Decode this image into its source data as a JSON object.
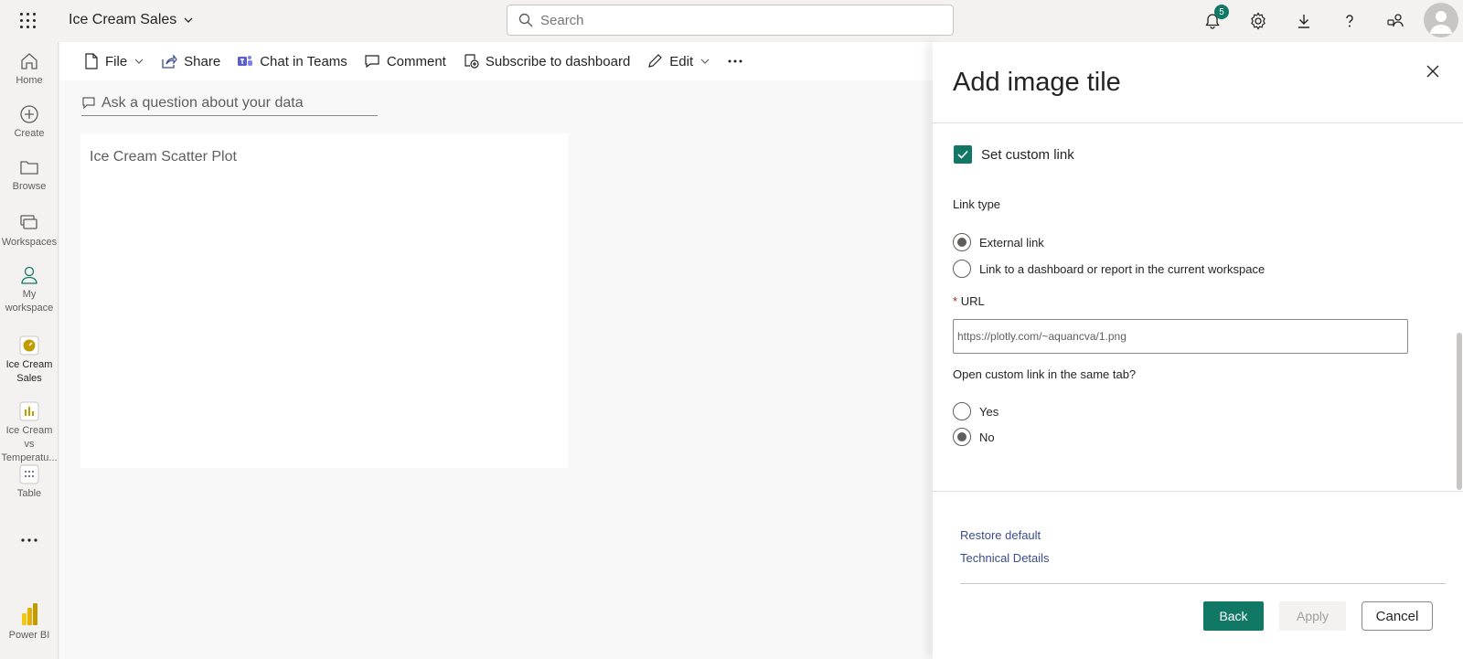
{
  "header": {
    "app_title": "Ice Cream Sales",
    "search_placeholder": "Search",
    "notification_count": "5"
  },
  "nav": {
    "home": "Home",
    "create": "Create",
    "browse": "Browse",
    "workspaces": "Workspaces",
    "my_workspace_1": "My",
    "my_workspace_2": "workspace",
    "ice_cream_sales_1": "Ice Cream",
    "ice_cream_sales_2": "Sales",
    "ice_vs_temp_1": "Ice Cream vs",
    "ice_vs_temp_2": "Temperatu...",
    "table": "Table",
    "power_bi": "Power BI"
  },
  "toolbar": {
    "file": "File",
    "share": "Share",
    "chat_in_teams": "Chat in Teams",
    "comment": "Comment",
    "subscribe": "Subscribe to dashboard",
    "edit": "Edit"
  },
  "canvas": {
    "qna_placeholder": "Ask a question about your data",
    "tile_title": "Ice Cream Scatter Plot"
  },
  "panel": {
    "title": "Add image tile",
    "set_custom_link": "Set custom link",
    "link_type_label": "Link type",
    "external_link": "External link",
    "dashboard_link": "Link to a dashboard or report in the current workspace",
    "url_required": "*",
    "url_label": "URL",
    "url_value": "https://plotly.com/~aquancva/1.png",
    "same_tab_label": "Open custom link in the same tab?",
    "yes": "Yes",
    "no": "No",
    "restore_default": "Restore default",
    "technical_details": "Technical Details",
    "back": "Back",
    "apply": "Apply",
    "cancel": "Cancel"
  },
  "colors": {
    "accent": "#117865",
    "link": "#3b4d8c"
  }
}
